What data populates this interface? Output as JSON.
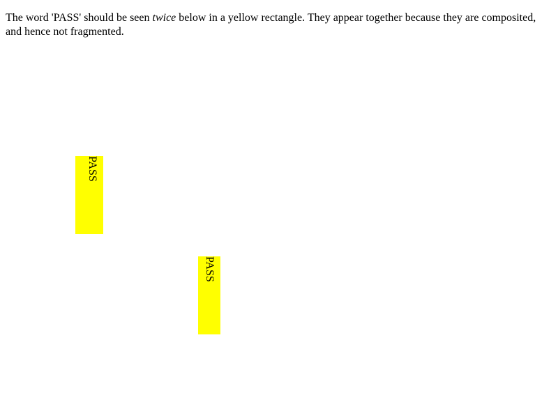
{
  "page": {
    "intro": {
      "part1": "The word 'PASS' should be seen ",
      "emphasis": "twice",
      "part2": " below in a yellow rectangle. They appear together because they are composited, and hence not fragmented."
    },
    "boxes": [
      {
        "label": "PASS"
      },
      {
        "label": "PASS"
      }
    ],
    "colors": {
      "background": "#ffffff",
      "box": "#ffff00",
      "text": "#000000"
    }
  }
}
